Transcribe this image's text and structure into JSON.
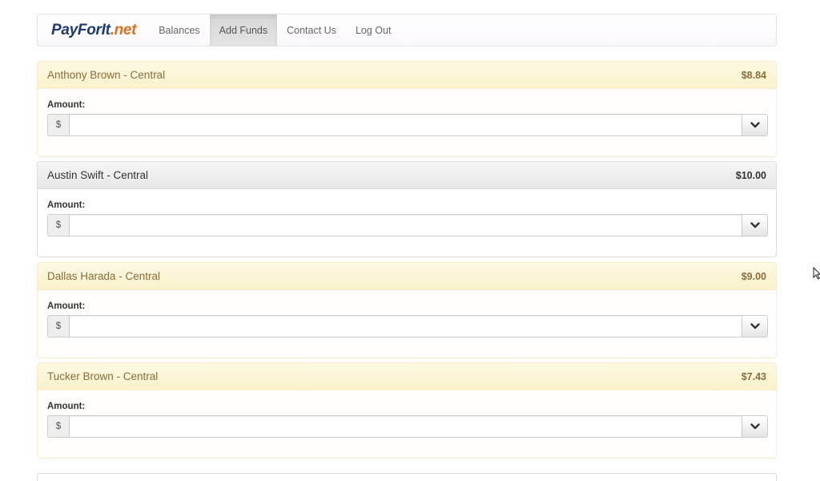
{
  "brand": {
    "main": "PayForIt",
    "accent": ".net"
  },
  "nav": {
    "items": [
      {
        "label": "Balances",
        "active": false
      },
      {
        "label": "Add Funds",
        "active": true
      },
      {
        "label": "Contact Us",
        "active": false
      },
      {
        "label": "Log Out",
        "active": false
      }
    ]
  },
  "accounts": [
    {
      "name": "Anthony Brown - Central",
      "balance": "$8.84",
      "amount_label": "Amount:",
      "currency": "$",
      "amount_value": "",
      "style": "warning"
    },
    {
      "name": "Austin Swift - Central",
      "balance": "$10.00",
      "amount_label": "Amount:",
      "currency": "$",
      "amount_value": "",
      "style": "default"
    },
    {
      "name": "Dallas Harada - Central",
      "balance": "$9.00",
      "amount_label": "Amount:",
      "currency": "$",
      "amount_value": "",
      "style": "warning"
    },
    {
      "name": "Tucker Brown - Central",
      "balance": "$7.43",
      "amount_label": "Amount:",
      "currency": "$",
      "amount_value": "",
      "style": "warning"
    }
  ],
  "icons": {
    "dropdown": "chevron-down-icon",
    "cursor": "mouse-pointer-icon"
  },
  "colors": {
    "brand_main": "#1f3a6e",
    "brand_accent": "#d9701c",
    "warning_text": "#8a6d3b",
    "warning_bg": "#fcf8e3",
    "default_bg": "#f5f5f5"
  }
}
